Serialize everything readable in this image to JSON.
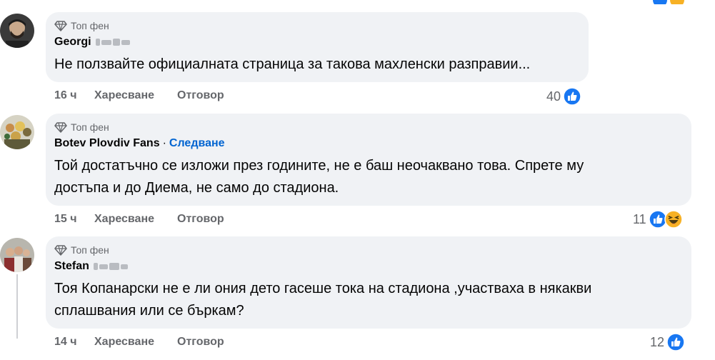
{
  "comments": [
    {
      "badge": "Топ фен",
      "author": "Georgi",
      "author_obscured": true,
      "follow": "",
      "text": "Не ползвайте официалната страница за такова махленски разправии...",
      "time": "16 ч",
      "like": "Харесване",
      "reply": "Отговор",
      "reaction_count": "40",
      "reactions": [
        "like-icon"
      ]
    },
    {
      "badge": "Топ фен",
      "author": "Botev Plovdiv Fans",
      "author_obscured": false,
      "separator": "·",
      "follow": "Следване",
      "text": "Той достатъчно се изложи през годините, не е баш неочаквано това. Спрете му\nдостъпа и до Диема, не само до стадиона.",
      "time": "15 ч",
      "like": "Харесване",
      "reply": "Отговор",
      "reaction_count": "11",
      "reactions": [
        "like-icon",
        "haha-icon"
      ]
    },
    {
      "badge": "Топ фен",
      "author": "Stefan",
      "author_obscured": true,
      "follow": "",
      "text": "Тоя Копанарски не е ли ония дето гасеше тока на стадиона ,участваха в някакви\nсплашвания или се бъркам?",
      "time": "14 ч",
      "like": "Харесване",
      "reply": "Отговор",
      "reaction_count": "12",
      "reactions": [
        "like-icon"
      ]
    }
  ],
  "colors": {
    "bubble": "#f0f2f5",
    "secondary_text": "#65676b",
    "link": "#0064d1",
    "like_blue": "#1877f2",
    "haha_yellow": "#f7b125"
  }
}
